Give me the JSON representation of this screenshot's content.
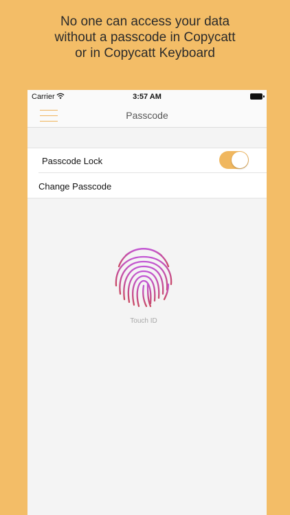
{
  "colors": {
    "background": "#f3bd67",
    "accent": "#f0b75f",
    "fingerprint_top": "#c256d4",
    "fingerprint_bottom": "#c84862"
  },
  "promo": {
    "line1": "No one can access your data",
    "line2": "without a passcode in Copycatt",
    "line3": "or in Copycatt Keyboard"
  },
  "status_bar": {
    "carrier": "Carrier",
    "wifi_icon": "wifi-icon",
    "time": "3:57 AM",
    "battery_icon": "battery-icon"
  },
  "nav": {
    "menu_icon": "hamburger-menu-icon",
    "title": "Passcode"
  },
  "settings": {
    "passcode_lock": {
      "label": "Passcode Lock",
      "enabled": true
    },
    "change_passcode": {
      "label": "Change Passcode"
    }
  },
  "touch_id": {
    "icon": "fingerprint-icon",
    "label": "Touch ID"
  }
}
